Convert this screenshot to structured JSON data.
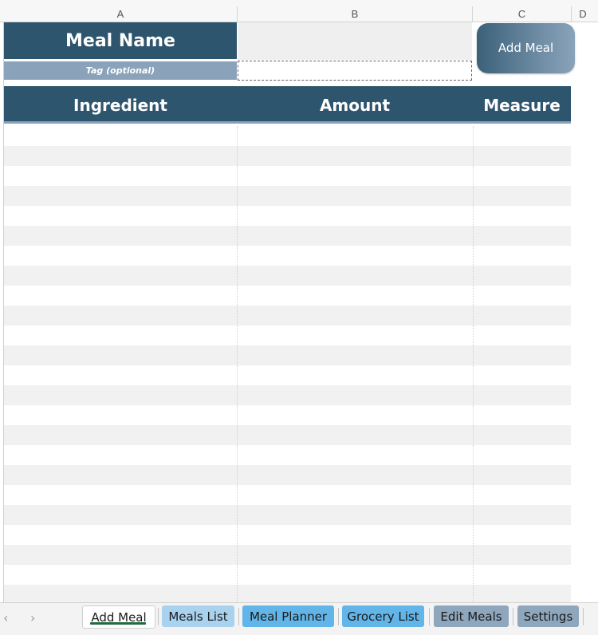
{
  "columns": [
    "A",
    "B",
    "C",
    "D"
  ],
  "form": {
    "meal_name_label": "Meal Name",
    "tag_label": "Tag (optional)",
    "meal_name_value": "",
    "tag_value": "",
    "add_button_label": "Add Meal"
  },
  "table": {
    "headers": [
      "Ingredient",
      "Amount",
      "Measure"
    ]
  },
  "sheet_tabs": [
    "Add Meal",
    "Meals List",
    "Meal Planner",
    "Grocery List",
    "Edit Meals",
    "Settings"
  ],
  "active_tab": "Add Meal",
  "nav": {
    "prev": "‹",
    "next": "›"
  },
  "colors": {
    "header_dark": "#2e556e",
    "header_light": "#8aa3ba",
    "tab_light_blue": "#a9d2ee",
    "tab_blue": "#62b5e8",
    "tab_gray": "#8fa7bd"
  }
}
